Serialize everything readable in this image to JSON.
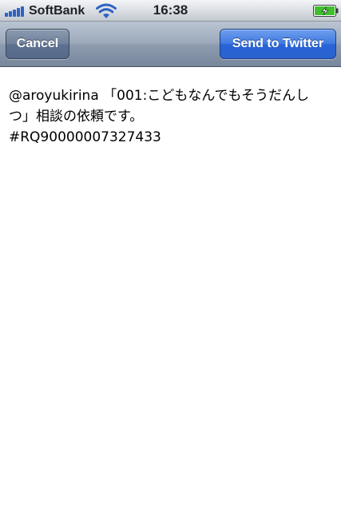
{
  "status_bar": {
    "carrier": "SoftBank",
    "time": "16:38",
    "icons": [
      "signal-icon",
      "wifi-icon",
      "battery-charging-icon"
    ],
    "signal_bars": 5,
    "battery_color": "#3fbf2e"
  },
  "nav": {
    "cancel_label": "Cancel",
    "send_label": "Send to Twitter"
  },
  "compose": {
    "text": "@aroyukirina 「001:こどもなんでもそうだんしつ」相談の依頼です。\n#RQ90000007327433"
  },
  "colors": {
    "send_button": "#2a62cf",
    "cancel_button": "#5d7190",
    "nav_bar": "#8e9cb0"
  }
}
